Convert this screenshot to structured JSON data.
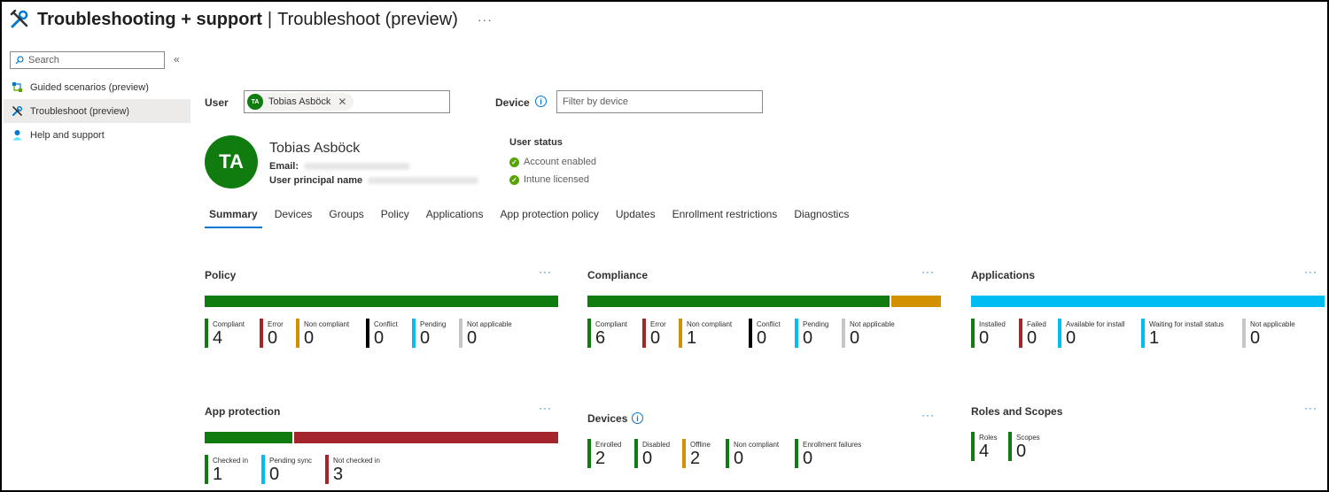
{
  "header": {
    "title": "Troubleshooting + support",
    "separator": "|",
    "subtitle": "Troubleshoot (preview)",
    "more": "···"
  },
  "sidebar": {
    "search_placeholder": "Search",
    "collapse": "«",
    "items": [
      {
        "label": "Guided scenarios (preview)",
        "icon": "guided-scenarios-icon"
      },
      {
        "label": "Troubleshoot (preview)",
        "icon": "tools-icon",
        "active": true
      },
      {
        "label": "Help and support",
        "icon": "support-person-icon"
      }
    ]
  },
  "filters": {
    "user_label": "User",
    "user_chip_initials": "TA",
    "user_chip_name": "Tobias Asböck",
    "user_chip_remove": "✕",
    "device_label": "Device",
    "device_placeholder": "Filter by device"
  },
  "profile": {
    "initials": "TA",
    "name": "Tobias Asböck",
    "email_label": "Email:",
    "upn_label": "User principal name",
    "status_heading": "User status",
    "status_items": [
      "Account enabled",
      "Intune licensed"
    ]
  },
  "tabs": [
    "Summary",
    "Devices",
    "Groups",
    "Policy",
    "Applications",
    "App protection policy",
    "Updates",
    "Enrollment restrictions",
    "Diagnostics"
  ],
  "colors": {
    "green": "#107c10",
    "red": "#a4262c",
    "orange": "#d29200",
    "black": "#000000",
    "cyan": "#00bcf2",
    "gray": "#c8c6c4",
    "accent": "#0078d4"
  },
  "cards": {
    "policy": {
      "title": "Policy",
      "more": "···",
      "stats": [
        {
          "label": "Compliant",
          "value": "4"
        },
        {
          "label": "Error",
          "value": "0"
        },
        {
          "label": "Non compliant",
          "value": "0"
        },
        {
          "label": "Conflict",
          "value": "0"
        },
        {
          "label": "Pending",
          "value": "0"
        },
        {
          "label": "Not applicable",
          "value": "0"
        }
      ]
    },
    "compliance": {
      "title": "Compliance",
      "more": "···",
      "stats": [
        {
          "label": "Compliant",
          "value": "6"
        },
        {
          "label": "Error",
          "value": "0"
        },
        {
          "label": "Non compliant",
          "value": "1"
        },
        {
          "label": "Conflict",
          "value": "0"
        },
        {
          "label": "Pending",
          "value": "0"
        },
        {
          "label": "Not applicable",
          "value": "0"
        }
      ]
    },
    "applications": {
      "title": "Applications",
      "more": "···",
      "stats": [
        {
          "label": "Installed",
          "value": "0"
        },
        {
          "label": "Failed",
          "value": "0"
        },
        {
          "label": "Available for install",
          "value": "0"
        },
        {
          "label": "Waiting for install status",
          "value": "1"
        },
        {
          "label": "Not applicable",
          "value": "0"
        }
      ]
    },
    "app_protection": {
      "title": "App protection",
      "more": "···",
      "stats": [
        {
          "label": "Checked in",
          "value": "1"
        },
        {
          "label": "Pending sync",
          "value": "0"
        },
        {
          "label": "Not checked in",
          "value": "3"
        }
      ]
    },
    "devices": {
      "title": "Devices",
      "more": "···",
      "stats": [
        {
          "label": "Enrolled",
          "value": "2"
        },
        {
          "label": "Disabled",
          "value": "0"
        },
        {
          "label": "Offline",
          "value": "2"
        },
        {
          "label": "Non compliant",
          "value": "0"
        },
        {
          "label": "Enrollment failures",
          "value": "0"
        }
      ]
    },
    "roles": {
      "title": "Roles and Scopes",
      "more": "···",
      "stats": [
        {
          "label": "Roles",
          "value": "4"
        },
        {
          "label": "Scopes",
          "value": "0"
        }
      ]
    }
  }
}
